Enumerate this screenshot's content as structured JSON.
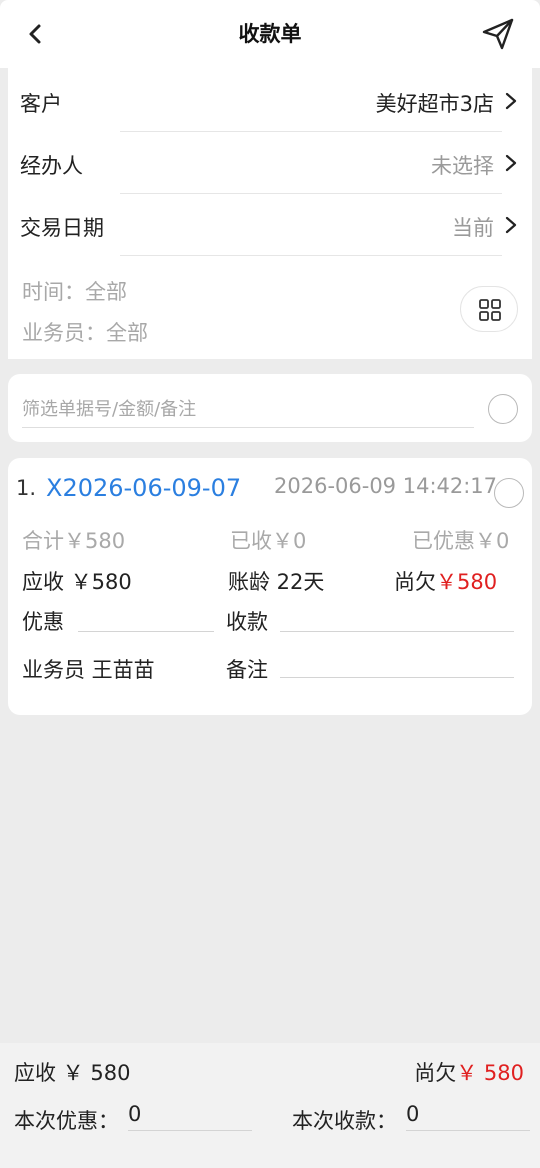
{
  "header": {
    "title": "收款单"
  },
  "form": {
    "customer": {
      "label": "客户",
      "value": "美好超市3店"
    },
    "handler": {
      "label": "经办人",
      "value": "未选择"
    },
    "trade_date": {
      "label": "交易日期",
      "value": "当前"
    },
    "filter_time": "时间：全部",
    "filter_salesman": "业务员：全部"
  },
  "search": {
    "placeholder": "筛选单据号/金额/备注"
  },
  "record": {
    "index": "1.",
    "number": "X2026-06-09-07",
    "datetime": "2026-06-09 14:42:17",
    "total_label": "合计￥580",
    "received_label": "已收￥0",
    "discounted_label": "已优惠￥0",
    "receivable_label": "应收 ￥580",
    "age_label": "账龄 22天",
    "owed_label": "尚欠",
    "owed_value": "￥580",
    "discount_label": "优惠",
    "payment_label": "收款",
    "salesman_label": "业务员 王苗苗",
    "remark_label": "备注"
  },
  "footer": {
    "receivable_label": "应收 ￥ 580",
    "owed_label": "尚欠",
    "owed_value": "￥ 580",
    "this_discount_label": "本次优惠：",
    "this_discount_value": "0",
    "this_payment_label": "本次收款：",
    "this_payment_value": "0"
  },
  "colors": {
    "accent_blue": "#2b7fe0",
    "owed_red": "#e02020",
    "muted_gray": "#a9a9a9"
  },
  "icons": {
    "back": "chevron-left-icon",
    "send": "paper-plane-icon",
    "chevron": "chevron-right-icon",
    "grid": "grid-icon",
    "checkbox": "circle-icon"
  }
}
